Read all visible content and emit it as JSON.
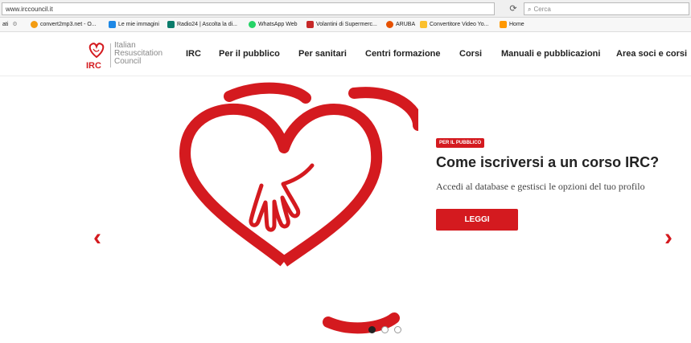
{
  "browser": {
    "url": "www.irccouncil.it",
    "search_placeholder": "Cerca",
    "bookmarks": [
      {
        "label": "ati",
        "color": "#888"
      },
      {
        "label": "convert2mp3.net - O...",
        "color": "#f39c12"
      },
      {
        "label": "Le mie immagini",
        "color": "#1e88e5"
      },
      {
        "label": "Radio24 | Ascolta la di...",
        "color": "#0a7c6b"
      },
      {
        "label": "WhatsApp Web",
        "color": "#25d366"
      },
      {
        "label": "Volantini di Supermerc...",
        "color": "#c62828"
      },
      {
        "label": "ARUBA",
        "color": "#e65100"
      },
      {
        "label": "Convertitore Video Yo...",
        "color": "#fbc02d"
      },
      {
        "label": "Home",
        "color": "#ff9800"
      }
    ]
  },
  "site": {
    "logo": {
      "line1": "Italian",
      "line2": "Resuscitation",
      "line3": "Council",
      "mark": "IRC"
    },
    "nav": [
      "IRC",
      "Per il pubblico",
      "Per sanitari",
      "Centri formazione",
      "Corsi",
      "Manuali e pubblicazioni",
      "Area soci e corsi"
    ]
  },
  "hero": {
    "badge": "PER IL PUBBLICO",
    "title": "Come iscriversi a un corso IRC?",
    "description": "Accedi al database e gestisci le opzioni del tuo profilo",
    "button": "LEGGI",
    "prev_icon": "chevron-left-icon",
    "next_icon": "chevron-right-icon",
    "dots_count": 3,
    "active_dot": 0
  },
  "colors": {
    "brand_red": "#d41a1f"
  }
}
